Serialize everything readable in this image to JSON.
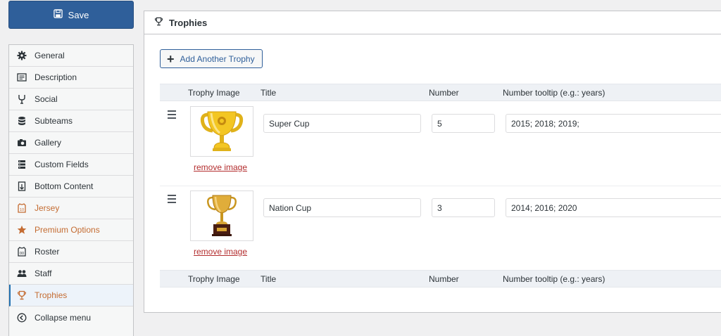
{
  "save_label": "Save",
  "menu": [
    {
      "label": "General",
      "icon": "gear-icon"
    },
    {
      "label": "Description",
      "icon": "description-icon"
    },
    {
      "label": "Social",
      "icon": "social-icon"
    },
    {
      "label": "Subteams",
      "icon": "database-icon"
    },
    {
      "label": "Gallery",
      "icon": "camera-icon"
    },
    {
      "label": "Custom Fields",
      "icon": "fields-icon"
    },
    {
      "label": "Bottom Content",
      "icon": "bottom-content-icon"
    },
    {
      "label": "Jersey",
      "icon": "jersey-icon"
    },
    {
      "label": "Premium Options",
      "icon": "star-icon"
    },
    {
      "label": "Roster",
      "icon": "roster-icon"
    },
    {
      "label": "Staff",
      "icon": "users-icon"
    },
    {
      "label": "Trophies",
      "icon": "trophy-icon"
    },
    {
      "label": "Collapse menu",
      "icon": "collapse-icon"
    }
  ],
  "panel": {
    "title": "Trophies",
    "add_label": "Add Another Trophy"
  },
  "table": {
    "headers": [
      "Trophy Image",
      "Title",
      "Number",
      "Number tooltip (e.g.: years)"
    ],
    "remove_label": "remove image",
    "rows": [
      {
        "title": "Super Cup",
        "number": "5",
        "tooltip": "2015; 2018; 2019;"
      },
      {
        "title": "Nation Cup",
        "number": "3",
        "tooltip": "2014; 2016; 2020"
      }
    ]
  },
  "colors": {
    "accent": "#2f5f9a",
    "pro": "#c46c32",
    "remove": "#b32d2e"
  }
}
